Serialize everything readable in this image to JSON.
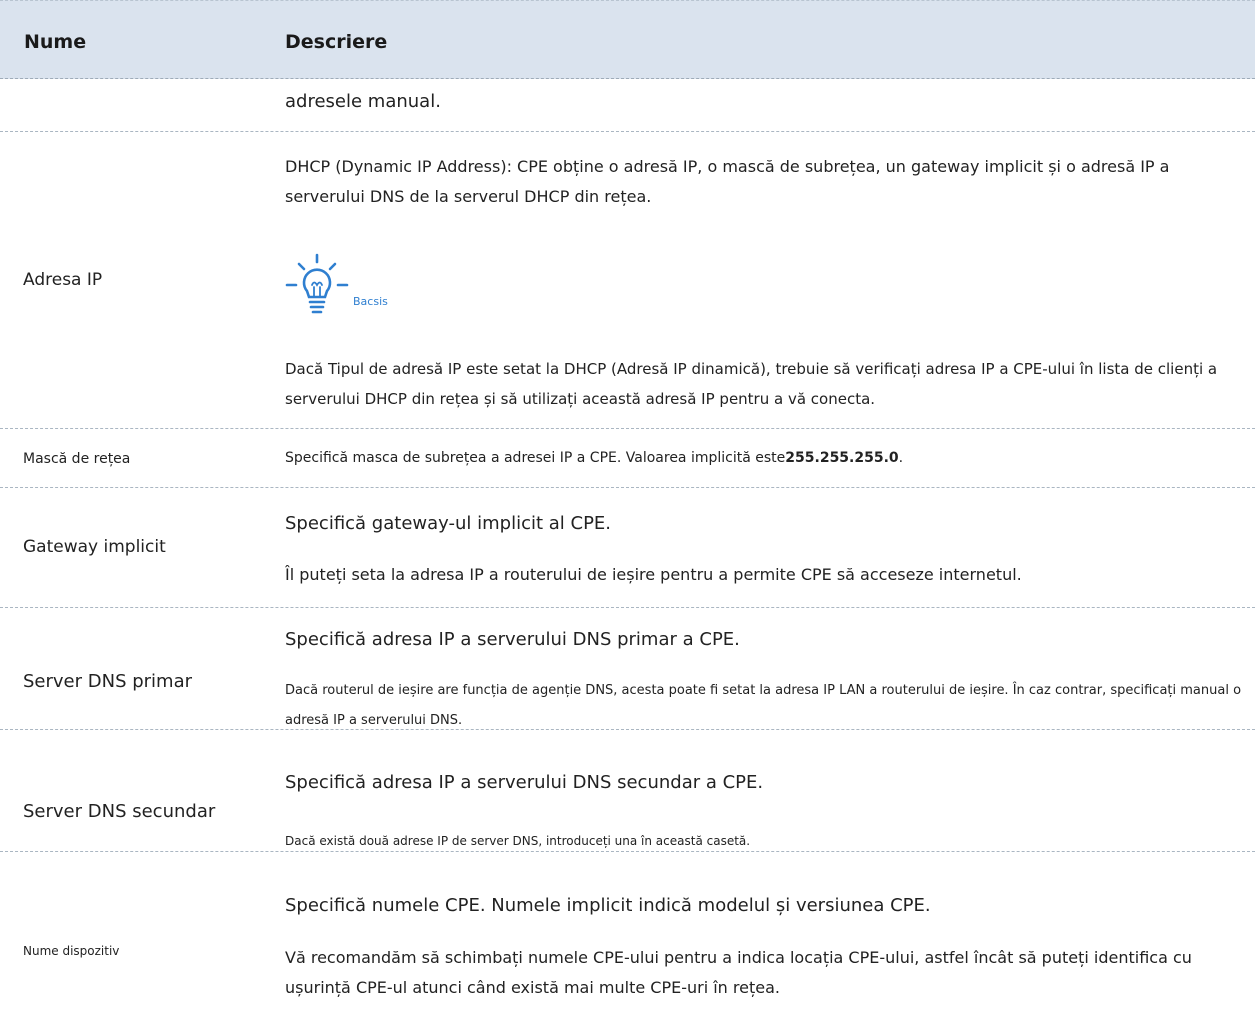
{
  "header": {
    "name": "Nume",
    "description": "Descriere"
  },
  "rows": [
    {
      "description": "adresele manual."
    },
    {
      "name": "Adresa IP",
      "description1": "DHCP (Dynamic IP Address): CPE obține o adresă IP, o mască de subrețea, un gateway implicit și o adresă IP a serverului DNS de la serverul DHCP din rețea.",
      "tip_label": "Bacsis",
      "description2": "Dacă Tipul de adresă IP este setat la DHCP (Adresă IP dinamică), trebuie să verificați adresa IP a CPE-ului în lista de clienți a serverului DHCP din rețea și să utilizați această adresă IP pentru a vă conecta."
    },
    {
      "name": "Mască de rețea",
      "description_prefix": "Specifică masca de subrețea a adresei IP a CPE. Valoarea implicită este",
      "description_bold": "255.255.255.0",
      "description_suffix": "."
    },
    {
      "name": "Gateway implicit",
      "description1": "Specifică gateway-ul implicit al CPE.",
      "description2": "Îl puteți seta la adresa IP a routerului de ieșire pentru a permite CPE să acceseze internetul."
    },
    {
      "name": "Server DNS primar",
      "description1": "Specifică adresa IP a serverului DNS primar a CPE.",
      "description2": "Dacă routerul de ieșire are funcția de agenție DNS, acesta poate fi setat la adresa IP LAN a routerului de ieșire. În caz contrar, specificați manual o adresă IP a serverului DNS."
    },
    {
      "name": "Server DNS secundar",
      "description1": "Specifică adresa IP a serverului DNS secundar a CPE.",
      "description2": "Dacă există două adrese IP de server DNS, introduceți una în această casetă."
    },
    {
      "name": "Nume dispozitiv",
      "description1": "Specifică numele CPE. Numele implicit indică modelul și versiunea CPE.",
      "description2": "Vă recomandăm să schimbați numele CPE-ului pentru a indica locația CPE-ului, astfel încât să puteți identifica cu ușurință CPE-ul atunci când există mai multe CPE-uri în rețea."
    }
  ],
  "colors": {
    "header_bg": "#dae3ee",
    "tip_icon": "#2f7fd0"
  },
  "icons": {
    "tip": "lightbulb-icon"
  }
}
